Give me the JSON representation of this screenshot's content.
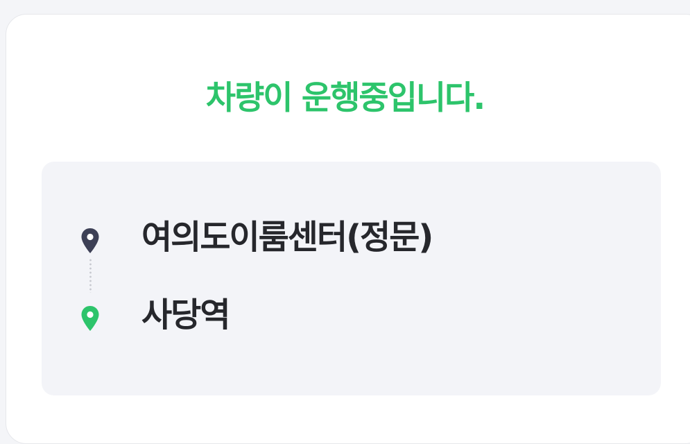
{
  "status": {
    "message": "차량이 운행중입니다.",
    "color": "#2dc46b"
  },
  "route": {
    "origin": {
      "name": "여의도이룸센터(정문)",
      "icon": "location-pin-icon",
      "icon_color": "#3d4056"
    },
    "destination": {
      "name": "사당역",
      "icon": "location-pin-icon",
      "icon_color": "#2dc46b"
    }
  }
}
